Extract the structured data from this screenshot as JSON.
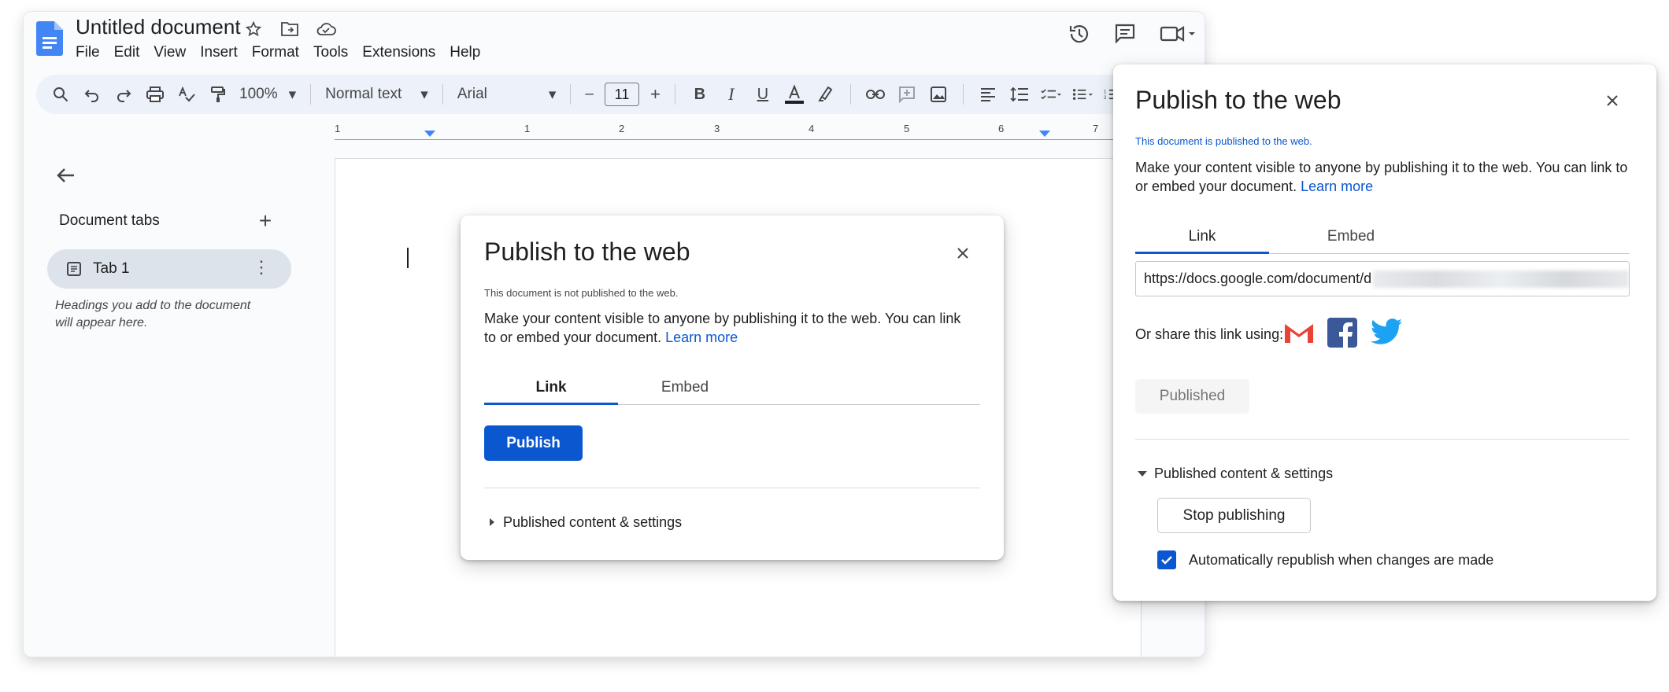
{
  "document": {
    "title": "Untitled document",
    "menu": [
      "File",
      "Edit",
      "View",
      "Insert",
      "Format",
      "Tools",
      "Extensions",
      "Help"
    ]
  },
  "toolbar": {
    "zoom": "100%",
    "style": "Normal text",
    "font": "Arial",
    "font_size": "11",
    "minus": "–",
    "plus": "+"
  },
  "ruler": {
    "numbers": [
      "1",
      "1",
      "2",
      "3",
      "4",
      "5",
      "6",
      "7"
    ]
  },
  "sidebar": {
    "heading": "Document tabs",
    "tab_label": "Tab 1",
    "hint": "Headings you add to the document will appear here."
  },
  "dialog_unpublished": {
    "title": "Publish to the web",
    "status": "This document is not published to the web.",
    "description": "Make your content visible to anyone by publishing it to the web. You can link to or embed your document.",
    "learn_more": "Learn more",
    "tab_link": "Link",
    "tab_embed": "Embed",
    "publish_button": "Publish",
    "settings_label": "Published content & settings"
  },
  "dialog_published": {
    "title": "Publish to the web",
    "status": "This document is published to the web.",
    "description": "Make your content visible to anyone by publishing it to the web. You can link to or embed your document.",
    "learn_more": "Learn more",
    "tab_link": "Link",
    "tab_embed": "Embed",
    "url_visible": "https://docs.google.com/document/d",
    "share_label": "Or share this link using:",
    "published_button": "Published",
    "settings_label": "Published content & settings",
    "stop_button": "Stop publishing",
    "auto_republish_label": "Automatically republish when changes are made",
    "auto_republish_checked": true
  },
  "colors": {
    "accent": "#0b57d0",
    "docs_blue": "#4285f4",
    "toolbar_bg": "#edf2fa",
    "tab_selected_bg": "#dde3ea"
  },
  "icons": {
    "share_targets": [
      "gmail-icon",
      "facebook-icon",
      "twitter-icon"
    ]
  }
}
